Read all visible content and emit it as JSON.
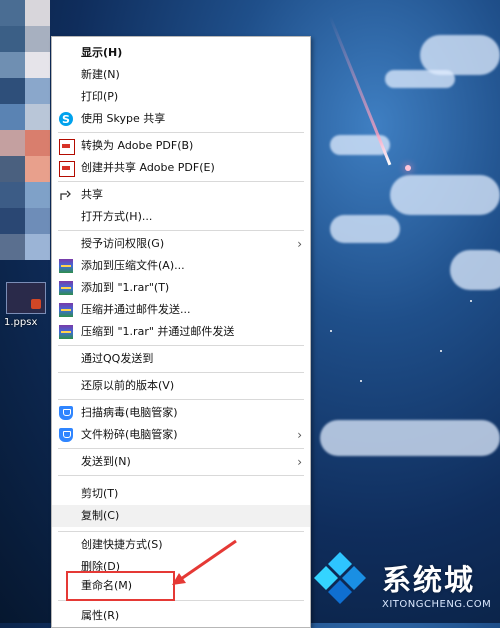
{
  "desktop": {
    "file_label": "1.ppsx",
    "mosaic_colors": [
      "#4a6d93",
      "#d8d6db",
      "#3b5f86",
      "#a7b0c0",
      "#6f8fb2",
      "#e6e4ea",
      "#2e4f7a",
      "#8aa7cb",
      "#5a83b3",
      "#b9c6d8",
      "#c4a0a0",
      "#d97e6d",
      "#4a607f",
      "#e8a08c",
      "#3c5c86",
      "#7fa1c8",
      "#2a4773",
      "#6e8db8",
      "#5a6f8f",
      "#9bb4d6"
    ]
  },
  "menu": {
    "items": [
      {
        "label": "显示(H)",
        "icon": "",
        "bold": true
      },
      {
        "label": "新建(N)",
        "icon": ""
      },
      {
        "label": "打印(P)",
        "icon": ""
      },
      {
        "label": "使用 Skype 共享",
        "icon": "skype-icon"
      },
      {
        "label": "转换为 Adobe PDF(B)",
        "icon": "adobe-pdf-icon"
      },
      {
        "label": "创建并共享 Adobe PDF(E)",
        "icon": "adobe-pdf-icon"
      },
      {
        "label": "共享",
        "icon": "share-icon"
      },
      {
        "label": "打开方式(H)...",
        "icon": ""
      },
      {
        "label": "授予访问权限(G)",
        "icon": "",
        "submenu": true
      },
      {
        "label": "添加到压缩文件(A)...",
        "icon": "winrar-icon"
      },
      {
        "label": "添加到 \"1.rar\"(T)",
        "icon": "winrar-icon"
      },
      {
        "label": "压缩并通过邮件发送...",
        "icon": "winrar-icon"
      },
      {
        "label": "压缩到 \"1.rar\" 并通过邮件发送",
        "icon": "winrar-icon"
      },
      {
        "label": "通过QQ发送到",
        "icon": ""
      },
      {
        "label": "还原以前的版本(V)",
        "icon": ""
      },
      {
        "label": "扫描病毒(电脑管家)",
        "icon": "tencent-shield-icon"
      },
      {
        "label": "文件粉碎(电脑管家)",
        "icon": "tencent-shield-icon",
        "submenu": true
      },
      {
        "label": "发送到(N)",
        "icon": "",
        "submenu": true
      },
      {
        "label": "剪切(T)",
        "icon": ""
      },
      {
        "label": "复制(C)",
        "icon": "",
        "hover": true
      },
      {
        "label": "创建快捷方式(S)",
        "icon": ""
      },
      {
        "label": "删除(D)",
        "icon": ""
      },
      {
        "label": "重命名(M)",
        "icon": "",
        "highlighted": true
      },
      {
        "label": "属性(R)",
        "icon": ""
      }
    ],
    "submenu_arrow": "›"
  },
  "annotation": {
    "color": "#e53935"
  },
  "watermark": {
    "brand": "系统城",
    "url": "XITONGCHENG.COM"
  }
}
